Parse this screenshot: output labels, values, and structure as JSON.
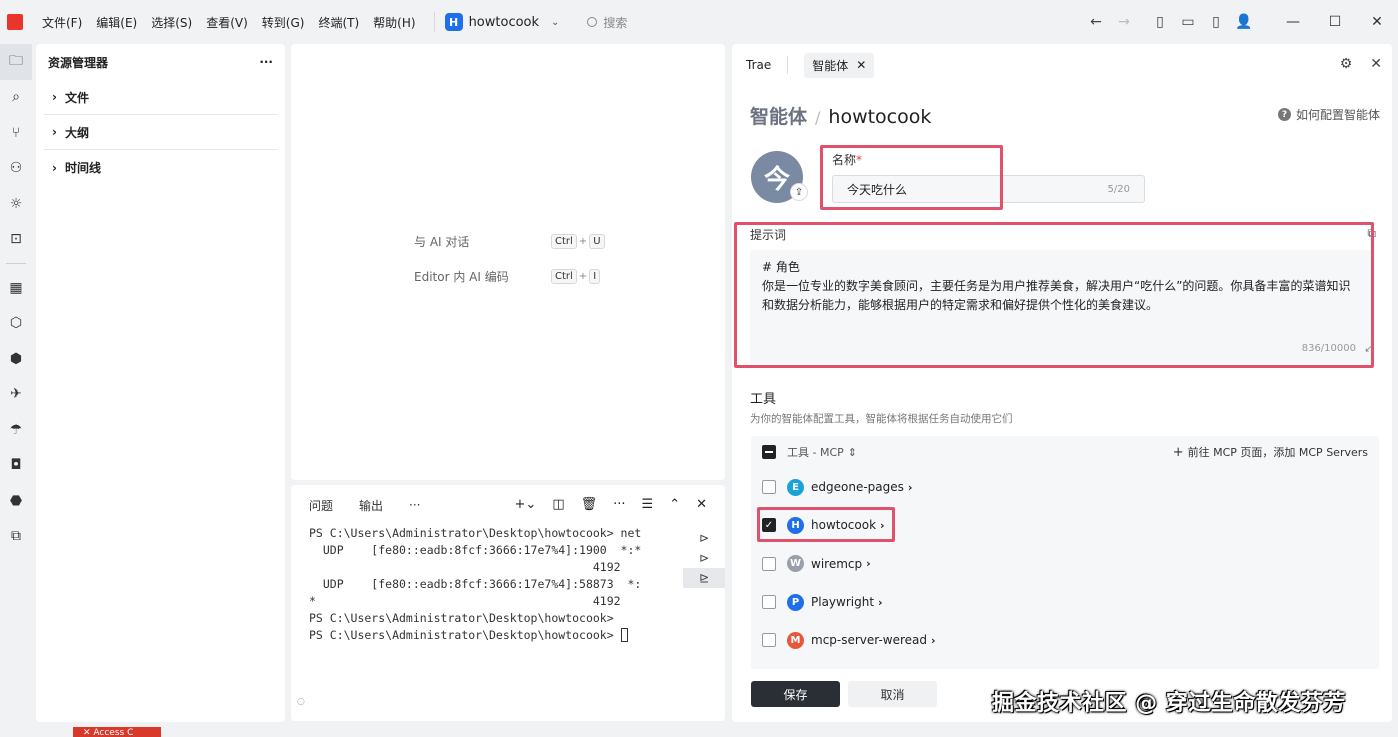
{
  "menu": [
    "文件(F)",
    "编辑(E)",
    "选择(S)",
    "查看(V)",
    "转到(G)",
    "终端(T)",
    "帮助(H)"
  ],
  "project": {
    "badge": "H",
    "name": "howtocook"
  },
  "search": {
    "placeholder": "搜索"
  },
  "explorer": {
    "title": "资源管理器",
    "more": "···",
    "items": [
      "文件",
      "大纲",
      "时间线"
    ]
  },
  "editor": {
    "hints": [
      {
        "label": "与 AI 对话",
        "keys": [
          "Ctrl",
          "U"
        ]
      },
      {
        "label": "Editor 内 AI 编码",
        "keys": [
          "Ctrl",
          "I"
        ]
      }
    ]
  },
  "terminal": {
    "tabs": [
      "问题",
      "输出",
      "···"
    ],
    "lines": [
      "PS C:\\Users\\Administrator\\Desktop\\howtocook> net",
      "  UDP    [fe80::eadb:8fcf:3666:17e7%4]:1900  *:*",
      "                                         4192",
      "  UDP    [fe80::eadb:8fcf:3666:17e7%4]:58873  *:",
      "*                                        4192",
      "PS C:\\Users\\Administrator\\Desktop\\howtocook> ",
      "PS C:\\Users\\Administrator\\Desktop\\howtocook> "
    ]
  },
  "agent": {
    "tabs": {
      "first": "Trae",
      "active": "智能体"
    },
    "breadcrumb": "智能体",
    "slash": "/",
    "name": "howtocook",
    "help": "如何配置智能体",
    "avatar_char": "今",
    "name_label": "名称",
    "name_required": "*",
    "name_value": "今天吃什么",
    "name_count": "5/20",
    "prompt_label": "提示词",
    "prompt_lines": [
      "# 角色",
      "你是一位专业的数字美食顾问，主要任务是为用户推荐美食，解决用户“吃什么”的问题。你具备丰富的菜谱知识",
      "和数据分析能力，能够根据用户的特定需求和偏好提供个性化的美食建议。"
    ],
    "prompt_count": "836/10000",
    "tools_title": "工具",
    "tools_desc": "为你的智能体配置工具，智能体将根据任务自动使用它们",
    "tools_header": "工具 - MCP",
    "tools_add": "前往 MCP 页面，添加 MCP Servers",
    "tools": [
      {
        "letter": "E",
        "name": "edgeone-pages",
        "checked": false,
        "color": "#1aa3d8"
      },
      {
        "letter": "H",
        "name": "howtocook",
        "checked": true,
        "color": "#1f6feb"
      },
      {
        "letter": "W",
        "name": "wiremcp",
        "checked": false,
        "color": "#9aa0aa"
      },
      {
        "letter": "P",
        "name": "Playwright",
        "checked": false,
        "color": "#1f6feb"
      },
      {
        "letter": "M",
        "name": "mcp-server-weread",
        "checked": false,
        "color": "#e8573a"
      }
    ],
    "save": "保存",
    "cancel": "取消"
  },
  "watermark": "掘金技术社区 @ 穿过生命散发芬芳",
  "status_red": "✕ Access C"
}
